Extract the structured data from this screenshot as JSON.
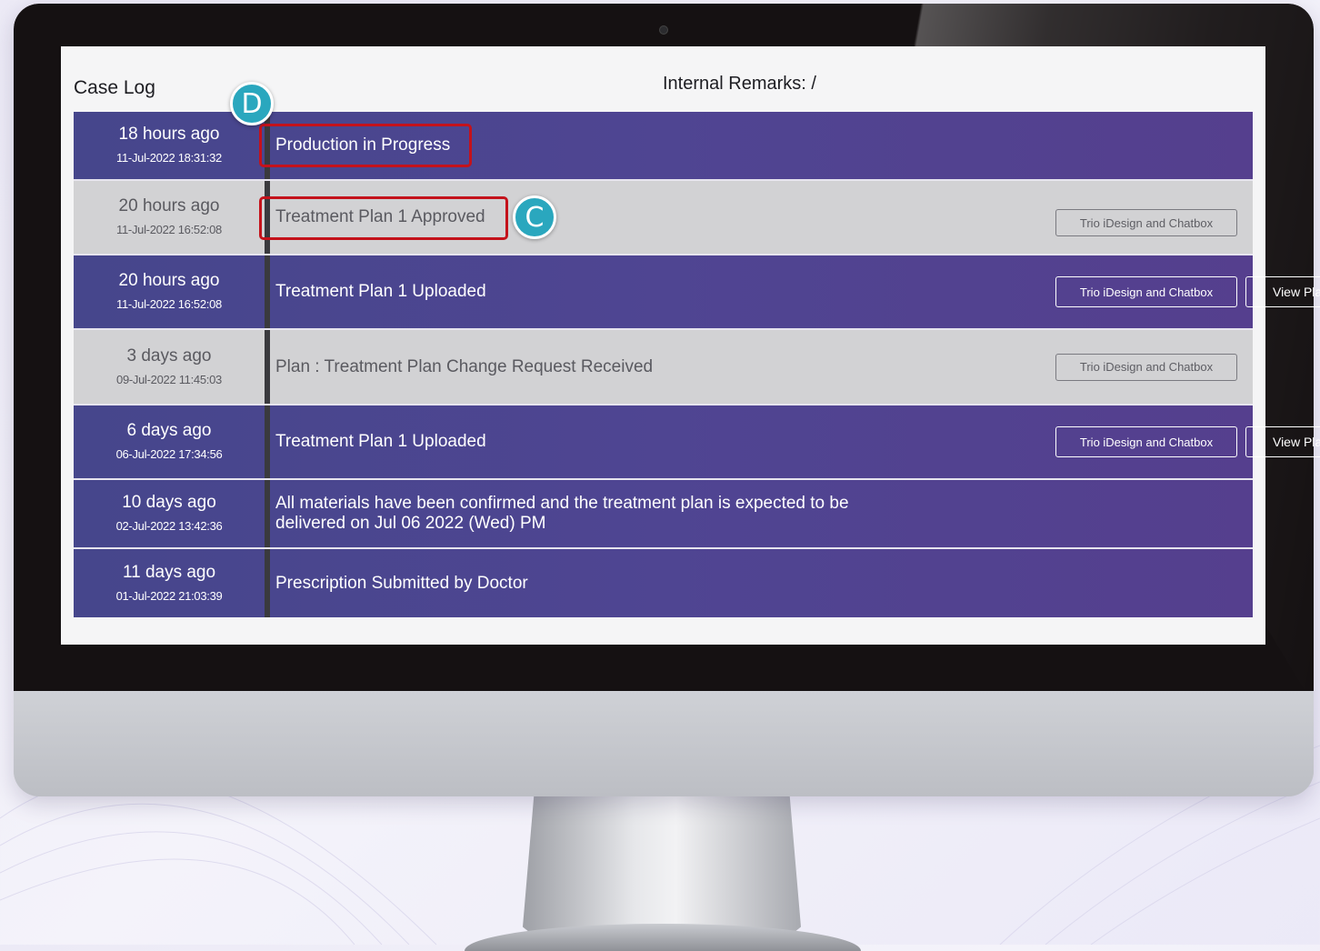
{
  "case_log": {
    "title": "Case Log",
    "internal_remarks": "Internal Remarks: /",
    "entries": [
      {
        "relative": "18 hours ago",
        "timestamp": "11-Jul-2022 18:31:32",
        "message": "Production in Progress",
        "style": "purple",
        "buttons": []
      },
      {
        "relative": "20 hours ago",
        "timestamp": "11-Jul-2022 16:52:08",
        "message": "Treatment Plan 1 Approved",
        "style": "grey",
        "buttons": [
          "Trio iDesign and Chatbox"
        ]
      },
      {
        "relative": "20 hours ago",
        "timestamp": "11-Jul-2022 16:52:08",
        "message": "Treatment Plan 1 Uploaded",
        "style": "purple",
        "buttons": [
          "Trio iDesign and Chatbox",
          "View Plan"
        ]
      },
      {
        "relative": "3 days ago",
        "timestamp": "09-Jul-2022 11:45:03",
        "message": "Plan : Treatment Plan Change Request Received",
        "style": "grey",
        "buttons": [
          "Trio iDesign and Chatbox"
        ]
      },
      {
        "relative": "6 days ago",
        "timestamp": "06-Jul-2022 17:34:56",
        "message": "Treatment Plan 1 Uploaded",
        "style": "purple",
        "buttons": [
          "Trio iDesign and Chatbox",
          "View Plan"
        ]
      },
      {
        "relative": "10 days ago",
        "timestamp": "02-Jul-2022 13:42:36",
        "message": "All materials have been confirmed and the treatment plan is expected to be delivered on Jul 06 2022 (Wed) PM",
        "style": "purple",
        "buttons": []
      },
      {
        "relative": "11 days ago",
        "timestamp": "01-Jul-2022 21:03:39",
        "message": "Prescription Submitted by Doctor",
        "style": "purple",
        "buttons": []
      }
    ]
  },
  "annotations": {
    "marker_d": "D",
    "marker_c": "C"
  },
  "colors": {
    "row_purple": "#4f4592",
    "row_grey": "#d2d2d4",
    "highlight": "#c4121b",
    "marker": "#2aa7be"
  }
}
